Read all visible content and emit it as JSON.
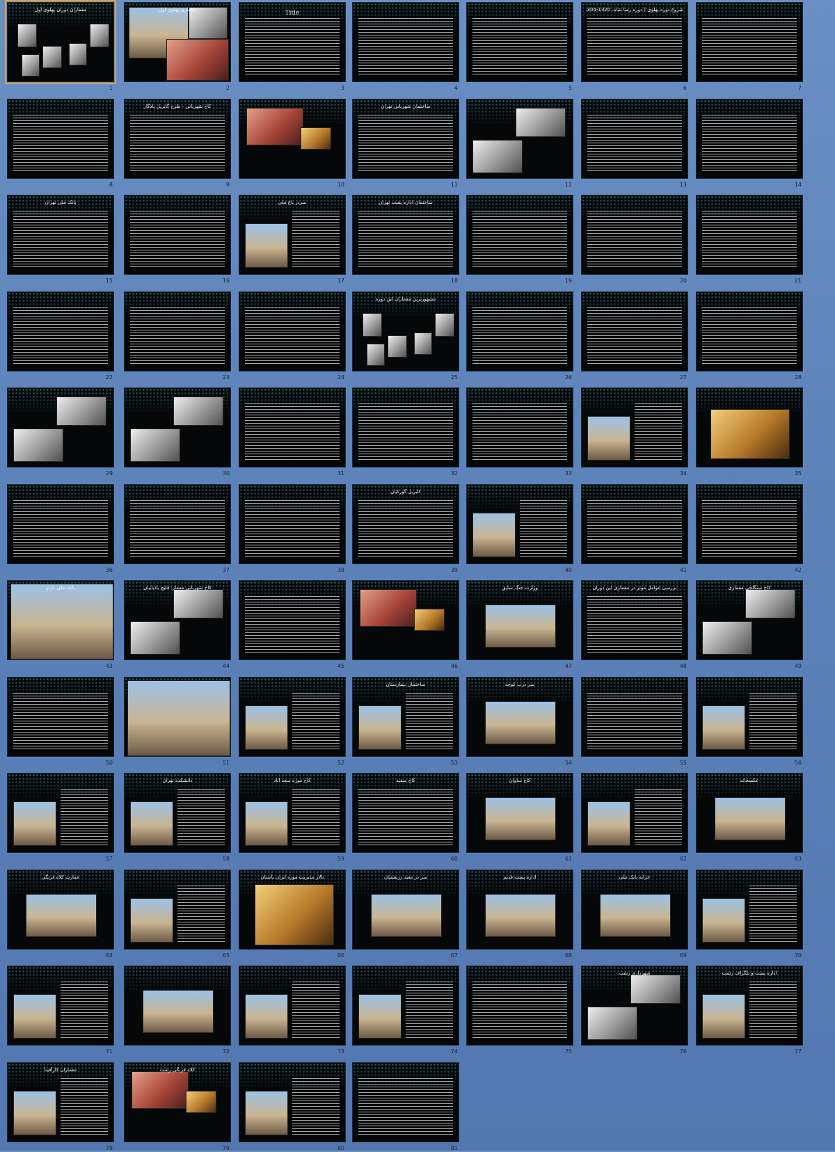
{
  "window": {
    "view": "slide-sorter",
    "selected_slide": 1
  },
  "slides": [
    {
      "n": "1",
      "title": "معماران دوران پهلوی اول",
      "kind": "portraits"
    },
    {
      "n": "2",
      "title": "معماری پهلوی اول",
      "kind": "photos"
    },
    {
      "n": "3",
      "title": "Title",
      "kind": "text"
    },
    {
      "n": "4",
      "title": "",
      "kind": "text"
    },
    {
      "n": "5",
      "title": "",
      "kind": "text"
    },
    {
      "n": "6",
      "title": "شروع دوره پهلوی ( دوره رضا شاه، 1320-1304 )",
      "kind": "text"
    },
    {
      "n": "7",
      "title": "",
      "kind": "text"
    },
    {
      "n": "8",
      "title": "",
      "kind": "text"
    },
    {
      "n": "9",
      "title": "کاخ شهربانی - طرح گابریل یادگار",
      "kind": "text"
    },
    {
      "n": "10",
      "title": "",
      "kind": "photo-red"
    },
    {
      "n": "11",
      "title": "ساختمان شهربانی تهران",
      "kind": "text"
    },
    {
      "n": "12",
      "title": "",
      "kind": "photos-bw"
    },
    {
      "n": "13",
      "title": "",
      "kind": "text"
    },
    {
      "n": "14",
      "title": "",
      "kind": "text"
    },
    {
      "n": "15",
      "title": "بانک ملی تهران",
      "kind": "text"
    },
    {
      "n": "16",
      "title": "",
      "kind": "text"
    },
    {
      "n": "17",
      "title": "سردر باغ ملی",
      "kind": "photo-text"
    },
    {
      "n": "18",
      "title": "ساختمان اداره پست تهران",
      "kind": "text"
    },
    {
      "n": "19",
      "title": "",
      "kind": "text"
    },
    {
      "n": "20",
      "title": "",
      "kind": "text"
    },
    {
      "n": "21",
      "title": "",
      "kind": "text"
    },
    {
      "n": "22",
      "title": "",
      "kind": "text"
    },
    {
      "n": "23",
      "title": "",
      "kind": "text"
    },
    {
      "n": "24",
      "title": "",
      "kind": "text"
    },
    {
      "n": "25",
      "title": "مشهورترین معماران این دوره",
      "kind": "portraits"
    },
    {
      "n": "26",
      "title": "",
      "kind": "text"
    },
    {
      "n": "27",
      "title": "",
      "kind": "text"
    },
    {
      "n": "28",
      "title": "",
      "kind": "text"
    },
    {
      "n": "29",
      "title": "",
      "kind": "photos-bw"
    },
    {
      "n": "30",
      "title": "",
      "kind": "photos-bw"
    },
    {
      "n": "31",
      "title": "",
      "kind": "text"
    },
    {
      "n": "32",
      "title": "",
      "kind": "text"
    },
    {
      "n": "33",
      "title": "",
      "kind": "text"
    },
    {
      "n": "34",
      "title": "",
      "kind": "photo-text"
    },
    {
      "n": "35",
      "title": "",
      "kind": "photo-gold"
    },
    {
      "n": "36",
      "title": "",
      "kind": "text"
    },
    {
      "n": "37",
      "title": "",
      "kind": "text"
    },
    {
      "n": "38",
      "title": "",
      "kind": "text"
    },
    {
      "n": "39",
      "title": "کابریل گورکیان",
      "kind": "text"
    },
    {
      "n": "40",
      "title": "",
      "kind": "photo-text"
    },
    {
      "n": "41",
      "title": "",
      "kind": "text"
    },
    {
      "n": "42",
      "title": "",
      "kind": "text"
    },
    {
      "n": "43",
      "title": "بانک ملی بازار",
      "kind": "photo-full"
    },
    {
      "n": "44",
      "title": "کاخ شهربانی معمار: فلیچ یادبانیان",
      "kind": "photos-bw"
    },
    {
      "n": "45",
      "title": "",
      "kind": "text"
    },
    {
      "n": "46",
      "title": "",
      "kind": "photo-red"
    },
    {
      "n": "47",
      "title": "وزارت جنگ سابق",
      "kind": "photo"
    },
    {
      "n": "48",
      "title": "بررسی عوامل موثر در معماری این دوران",
      "kind": "text"
    },
    {
      "n": "49",
      "title": "کاخ سنگلجی معماری",
      "kind": "photos-bw"
    },
    {
      "n": "50",
      "title": "",
      "kind": "text"
    },
    {
      "n": "51",
      "title": "",
      "kind": "photo-full"
    },
    {
      "n": "52",
      "title": "",
      "kind": "photo-text"
    },
    {
      "n": "53",
      "title": "ساختمان بیمارستان",
      "kind": "photo-text"
    },
    {
      "n": "54",
      "title": "سر درب کوچه",
      "kind": "photo"
    },
    {
      "n": "55",
      "title": "",
      "kind": "text"
    },
    {
      "n": "56",
      "title": "",
      "kind": "photo-text"
    },
    {
      "n": "57",
      "title": "",
      "kind": "photo-text"
    },
    {
      "n": "58",
      "title": "دانشکده تهران",
      "kind": "photo-text"
    },
    {
      "n": "59",
      "title": "کاخ موزه سعد آباد",
      "kind": "photo-text"
    },
    {
      "n": "60",
      "title": "کاخ سفید",
      "kind": "text"
    },
    {
      "n": "61",
      "title": "کاخ ساوان",
      "kind": "photo"
    },
    {
      "n": "62",
      "title": "",
      "kind": "photo-text"
    },
    {
      "n": "63",
      "title": "عکسخانه",
      "kind": "photo"
    },
    {
      "n": "64",
      "title": "عمارت کلاه فرنگی",
      "kind": "photo"
    },
    {
      "n": "65",
      "title": "",
      "kind": "photo-text"
    },
    {
      "n": "66",
      "title": "تالار مدیریت موزه ایران باستان",
      "kind": "photo-dark"
    },
    {
      "n": "67",
      "title": "سر در معبد زرتشتیان",
      "kind": "photo"
    },
    {
      "n": "68",
      "title": "اداره پست قدیم",
      "kind": "photo"
    },
    {
      "n": "69",
      "title": "خزانه بانک ملی",
      "kind": "photo"
    },
    {
      "n": "70",
      "title": "",
      "kind": "photo-text"
    },
    {
      "n": "71",
      "title": "",
      "kind": "photo-text"
    },
    {
      "n": "72",
      "title": "",
      "kind": "photo"
    },
    {
      "n": "73",
      "title": "",
      "kind": "photo-text"
    },
    {
      "n": "74",
      "title": "",
      "kind": "photo-text"
    },
    {
      "n": "75",
      "title": "",
      "kind": "text"
    },
    {
      "n": "76",
      "title": "شهرداری رشت",
      "kind": "photos-bw"
    },
    {
      "n": "77",
      "title": "اداره پست و تلگراف رشت",
      "kind": "photo-text"
    },
    {
      "n": "78",
      "title": "معماران کارآفینا",
      "kind": "photo-text"
    },
    {
      "n": "79",
      "title": "کلاه فرنگی رشت",
      "kind": "photo-red"
    },
    {
      "n": "80",
      "title": "",
      "kind": "photo-text"
    },
    {
      "n": "81",
      "title": "",
      "kind": "text"
    }
  ]
}
